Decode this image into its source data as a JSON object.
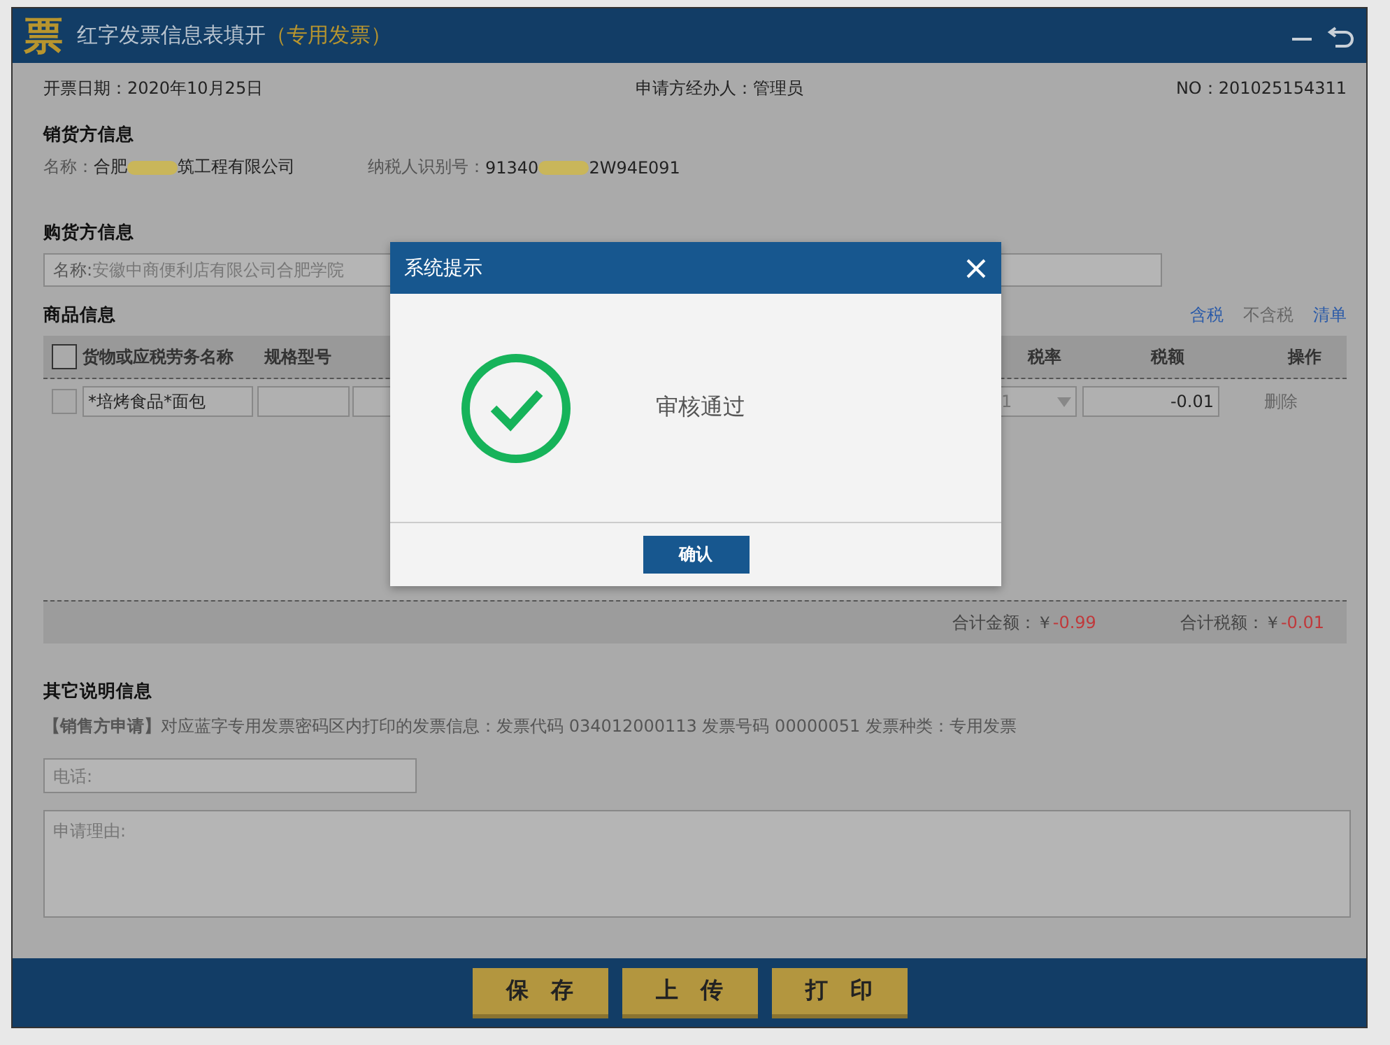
{
  "window": {
    "logo": "票",
    "title": "红字发票信息表填开",
    "title_tag": "（专用发票）"
  },
  "header": {
    "date": "开票日期：2020年10月25日",
    "handler": "申请方经办人：管理员",
    "number": "NO：201025154311"
  },
  "seller": {
    "heading": "销货方信息",
    "name_label": "名称：",
    "name_start": "合肥",
    "name_end": "筑工程有限公司",
    "tax_label": "纳税人识别号：",
    "tax_start": "91340",
    "tax_end": "2W94E091"
  },
  "buyer": {
    "heading": "购货方信息",
    "name_label": "名称:",
    "name_value": "安徽中商便利店有限公司合肥学院"
  },
  "goods": {
    "heading": "商品信息",
    "modes": [
      {
        "label": "含税",
        "disabled": false
      },
      {
        "label": "不含税",
        "disabled": true
      },
      {
        "label": "清单",
        "disabled": false
      }
    ],
    "select_all": {
      "checked": false
    },
    "columns": [
      "货物或应税劳务名称",
      "规格型号",
      "税率",
      "税额",
      "操作"
    ],
    "rows": [
      {
        "checked": false,
        "name": "*培烤食品*面包",
        "rate": "1",
        "tax": "-0.01",
        "action": "删除"
      }
    ],
    "total_amount_label": "合计金额：￥",
    "total_amount": "-0.99",
    "total_tax_label": "合计税额：￥",
    "total_tax": "-0.01"
  },
  "other": {
    "heading": "其它说明信息",
    "note_tag": "【销售方申请】",
    "note": "对应蓝字专用发票密码区内打印的发票信息：发票代码 034012000113 发票号码 00000051 发票种类：专用发票",
    "phone_placeholder": "电话:",
    "reason_placeholder": "申请理由:"
  },
  "buttons": [
    "保　存",
    "上　传",
    "打　印"
  ],
  "dialog": {
    "title": "系统提示",
    "message": "审核通过",
    "button": "确认"
  }
}
